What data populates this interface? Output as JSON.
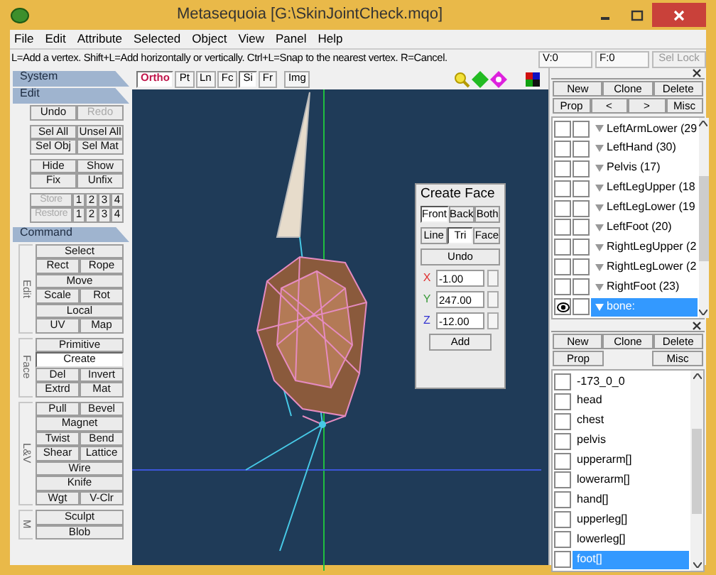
{
  "window": {
    "title": "Metasequoia [G:\\SkinJointCheck.mqo]"
  },
  "menu": [
    "File",
    "Edit",
    "Attribute",
    "Selected",
    "Object",
    "View",
    "Panel",
    "Help"
  ],
  "status_bar": {
    "hint": "L=Add a vertex.  Shift+L=Add horizontally or vertically.  Ctrl+L=Snap to the nearest vertex.  R=Cancel.",
    "vertices": "V:0",
    "faces": "F:0",
    "lock": {
      "label": "Sel Lock",
      "disabled": true
    }
  },
  "left_panel": {
    "sections": [
      {
        "title": "System"
      },
      {
        "title": "Edit",
        "groups": [
          {
            "rows": [
              [
                {
                  "label": "Undo",
                  "disabled": false
                },
                {
                  "label": "Redo",
                  "disabled": true
                }
              ]
            ]
          },
          {
            "rows": [
              [
                {
                  "label": "Sel All",
                  "disabled": false
                },
                {
                  "label": "Unsel All",
                  "disabled": false
                }
              ],
              [
                {
                  "label": "Sel Obj",
                  "disabled": false
                },
                {
                  "label": "Sel Mat",
                  "disabled": false
                }
              ]
            ]
          },
          {
            "rows": [
              [
                {
                  "label": "Hide",
                  "disabled": false
                },
                {
                  "label": "Show",
                  "disabled": false
                }
              ],
              [
                {
                  "label": "Fix",
                  "disabled": false
                },
                {
                  "label": "Unfix",
                  "disabled": false
                }
              ]
            ]
          },
          {
            "rows": [
              [
                {
                  "label": "Store",
                  "disabled": true
                },
                {
                  "label": "1",
                  "disabled": false
                },
                {
                  "label": "2",
                  "disabled": false
                },
                {
                  "label": "3",
                  "disabled": false
                },
                {
                  "label": "4",
                  "disabled": false
                }
              ],
              [
                {
                  "label": "Restore",
                  "disabled": true
                },
                {
                  "label": "1",
                  "disabled": false
                },
                {
                  "label": "2",
                  "disabled": false
                },
                {
                  "label": "3",
                  "disabled": false
                },
                {
                  "label": "4",
                  "disabled": false
                }
              ]
            ]
          }
        ]
      },
      {
        "title": "Command",
        "groups": [
          {
            "side": "Edit",
            "rows": [
              [
                {
                  "label": "Select",
                  "selected": false
                }
              ],
              [
                {
                  "label": "Rect",
                  "selected": false
                },
                {
                  "label": "Rope",
                  "selected": false
                }
              ],
              [
                {
                  "label": "Move",
                  "selected": false
                }
              ],
              [
                {
                  "label": "Scale",
                  "selected": false
                },
                {
                  "label": "Rot",
                  "selected": false
                }
              ],
              [
                {
                  "label": "Local",
                  "selected": false
                }
              ],
              [
                {
                  "label": "UV",
                  "selected": false
                },
                {
                  "label": "Map",
                  "selected": false
                }
              ]
            ]
          },
          {
            "side": "Face",
            "rows": [
              [
                {
                  "label": "Primitive",
                  "selected": false
                }
              ],
              [
                {
                  "label": "Create",
                  "selected": true
                }
              ],
              [
                {
                  "label": "Del",
                  "selected": false
                },
                {
                  "label": "Invert",
                  "selected": false
                }
              ],
              [
                {
                  "label": "Extrd",
                  "selected": false
                },
                {
                  "label": "Mat",
                  "selected": false
                }
              ]
            ]
          },
          {
            "side": "L&V",
            "rows": [
              [
                {
                  "label": "Pull",
                  "selected": false
                },
                {
                  "label": "Bevel",
                  "selected": false
                }
              ],
              [
                {
                  "label": "Magnet",
                  "selected": false
                }
              ],
              [
                {
                  "label": "Twist",
                  "selected": false
                },
                {
                  "label": "Bend",
                  "selected": false
                }
              ],
              [
                {
                  "label": "Shear",
                  "selected": false
                },
                {
                  "label": "Lattice",
                  "selected": false
                }
              ],
              [
                {
                  "label": "Wire",
                  "selected": false
                }
              ],
              [
                {
                  "label": "Knife",
                  "selected": false
                }
              ],
              [
                {
                  "label": "Wgt",
                  "selected": false
                },
                {
                  "label": "V-Clr",
                  "selected": false
                }
              ]
            ]
          },
          {
            "side": "M",
            "rows": [
              [
                {
                  "label": "Sculpt",
                  "selected": false
                }
              ],
              [
                {
                  "label": "Blob",
                  "selected": false
                }
              ]
            ]
          }
        ]
      }
    ]
  },
  "viewport": {
    "toolbar": [
      {
        "label": "Ortho",
        "selected": true
      },
      {
        "label": "Pt",
        "selected": false
      },
      {
        "label": "Ln",
        "selected": false
      },
      {
        "label": "Fc",
        "selected": false
      },
      {
        "label": "Si",
        "selected": true
      },
      {
        "label": "Fr",
        "selected": false
      },
      {
        "label": "Img",
        "selected": false
      }
    ],
    "create_face": {
      "title": "Create Face",
      "sides": [
        {
          "label": "Front",
          "selected": true
        },
        {
          "label": "Back",
          "selected": false
        },
        {
          "label": "Both",
          "selected": false
        }
      ],
      "modes": [
        {
          "label": "Line",
          "selected": false
        },
        {
          "label": "Tri",
          "selected": true
        },
        {
          "label": "Face",
          "selected": false
        }
      ],
      "undo": "Undo",
      "coords": [
        {
          "axis": "X",
          "color": "#e03030",
          "value": "-1.00"
        },
        {
          "axis": "Y",
          "color": "#3a9a3a",
          "value": "247.00"
        },
        {
          "axis": "Z",
          "color": "#3030d0",
          "value": "-12.00"
        }
      ],
      "add": "Add"
    }
  },
  "object_panel": {
    "buttons": [
      [
        "New",
        "Clone",
        "Delete"
      ],
      [
        "Prop",
        "<",
        ">",
        "Misc"
      ]
    ],
    "items": [
      {
        "label": "LeftArmLower (29",
        "visible": false,
        "locked": false,
        "selected": false
      },
      {
        "label": "LeftHand (30)",
        "visible": false,
        "locked": false,
        "selected": false
      },
      {
        "label": "Pelvis (17)",
        "visible": false,
        "locked": false,
        "selected": false
      },
      {
        "label": "LeftLegUpper (18",
        "visible": false,
        "locked": false,
        "selected": false
      },
      {
        "label": "LeftLegLower (19",
        "visible": false,
        "locked": false,
        "selected": false
      },
      {
        "label": "LeftFoot (20)",
        "visible": false,
        "locked": false,
        "selected": false
      },
      {
        "label": "RightLegUpper (2",
        "visible": false,
        "locked": false,
        "selected": false
      },
      {
        "label": "RightLegLower (2",
        "visible": false,
        "locked": false,
        "selected": false
      },
      {
        "label": "RightFoot (23)",
        "visible": false,
        "locked": false,
        "selected": false
      },
      {
        "label": "bone:",
        "visible": true,
        "locked": false,
        "selected": true
      }
    ]
  },
  "material_panel": {
    "buttons": [
      [
        "New",
        "Clone",
        "Delete"
      ],
      [
        "Prop",
        "Misc"
      ]
    ],
    "items": [
      {
        "label": "-173_0_0",
        "checked": false,
        "selected": false
      },
      {
        "label": "head",
        "checked": false,
        "selected": false
      },
      {
        "label": "chest",
        "checked": false,
        "selected": false
      },
      {
        "label": "pelvis",
        "checked": false,
        "selected": false
      },
      {
        "label": "upperarm[]",
        "checked": false,
        "selected": false
      },
      {
        "label": "lowerarm[]",
        "checked": false,
        "selected": false
      },
      {
        "label": "hand[]",
        "checked": false,
        "selected": false
      },
      {
        "label": "upperleg[]",
        "checked": false,
        "selected": false
      },
      {
        "label": "lowerleg[]",
        "checked": false,
        "selected": false
      },
      {
        "label": "foot[]",
        "checked": false,
        "selected": true
      }
    ]
  }
}
